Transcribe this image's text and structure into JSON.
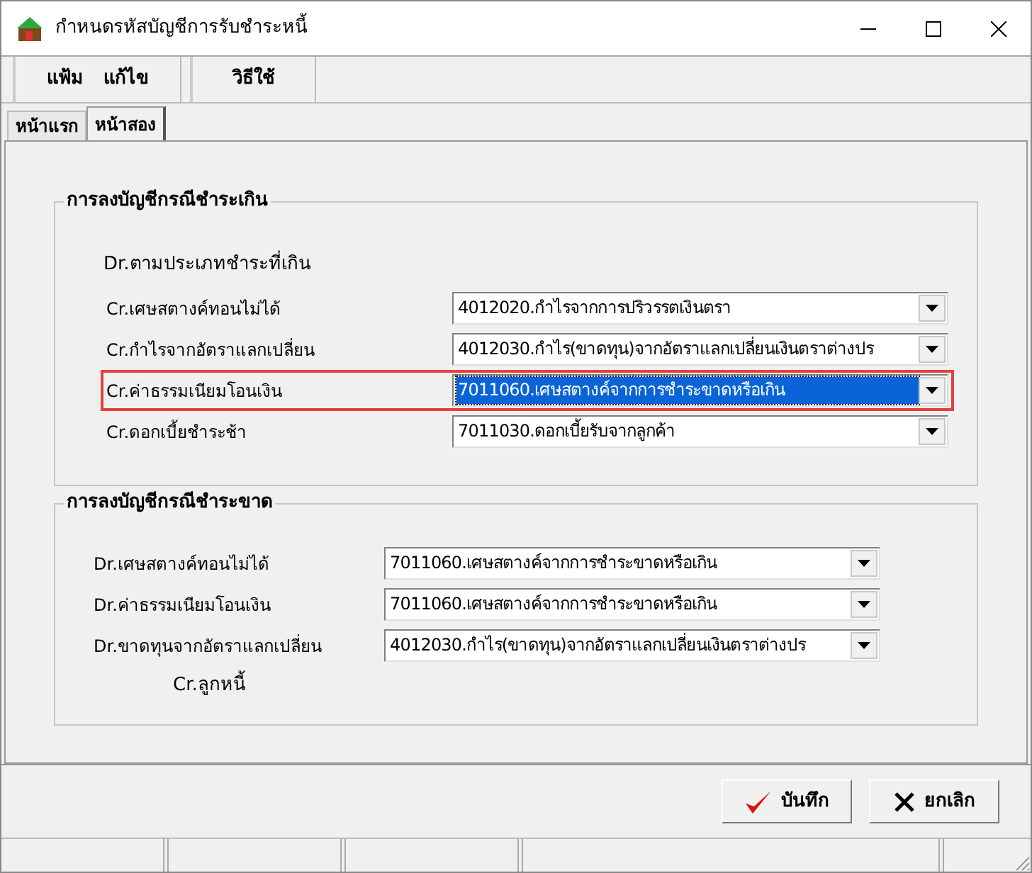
{
  "window": {
    "title": "กำหนดรหัสบัญชีการรับชำระหนี้"
  },
  "menu": [
    {
      "label": "แฟ้ม"
    },
    {
      "label": "แก้ไข"
    },
    {
      "label": "วิธีใช้"
    }
  ],
  "tabs": [
    {
      "label": "หน้าแรก",
      "selected": false
    },
    {
      "label": "หน้าสอง",
      "selected": true
    }
  ],
  "overpaid_group": {
    "title": "การลงบัญชีกรณีชำระเกิน",
    "debit_label": "Dr.ตามประเภทชำระที่เกิน",
    "rows": [
      {
        "label": "Cr.เศษสตางค์ทอนไม่ได้",
        "value": "4012020.กำไรจากการปริวรรตเงินตรา",
        "focused": false,
        "annotated": false
      },
      {
        "label": "Cr.กำไรจากอัตราแลกเปลี่ยน",
        "value": "4012030.กำไร(ขาดทุน)จากอัตราแลกเปลี่ยนเงินตราต่างปร",
        "focused": false,
        "annotated": false
      },
      {
        "label": "Cr.ค่าธรรมเนียมโอนเงิน",
        "value": "7011060.เศษสตางค์จากการชำระขาดหรือเกิน",
        "focused": true,
        "annotated": true
      },
      {
        "label": "Cr.ดอกเบี้ยชำระช้า",
        "value": "7011030.ดอกเบี้ยรับจากลูกค้า",
        "focused": false,
        "annotated": false
      }
    ]
  },
  "underpaid_group": {
    "title": "การลงบัญชีกรณีชำระขาด",
    "rows": [
      {
        "label": "Dr.เศษสตางค์ทอนไม่ได้",
        "value": "7011060.เศษสตางค์จากการชำระขาดหรือเกิน",
        "focused": false,
        "annotated": false
      },
      {
        "label": "Dr.ค่าธรรมเนียมโอนเงิน",
        "value": "7011060.เศษสตางค์จากการชำระขาดหรือเกิน",
        "focused": false,
        "annotated": false
      },
      {
        "label": "Dr.ขาดทุนจากอัตราแลกเปลี่ยน",
        "value": "4012030.กำไร(ขาดทุน)จากอัตราแลกเปลี่ยนเงินตราต่างปร",
        "focused": false,
        "annotated": false
      }
    ],
    "credit_label": "Cr.ลูกหนี้"
  },
  "buttons": [
    {
      "kind": "save",
      "label": "บันทึก"
    },
    {
      "kind": "cancel",
      "label": "ยกเลิก"
    }
  ]
}
